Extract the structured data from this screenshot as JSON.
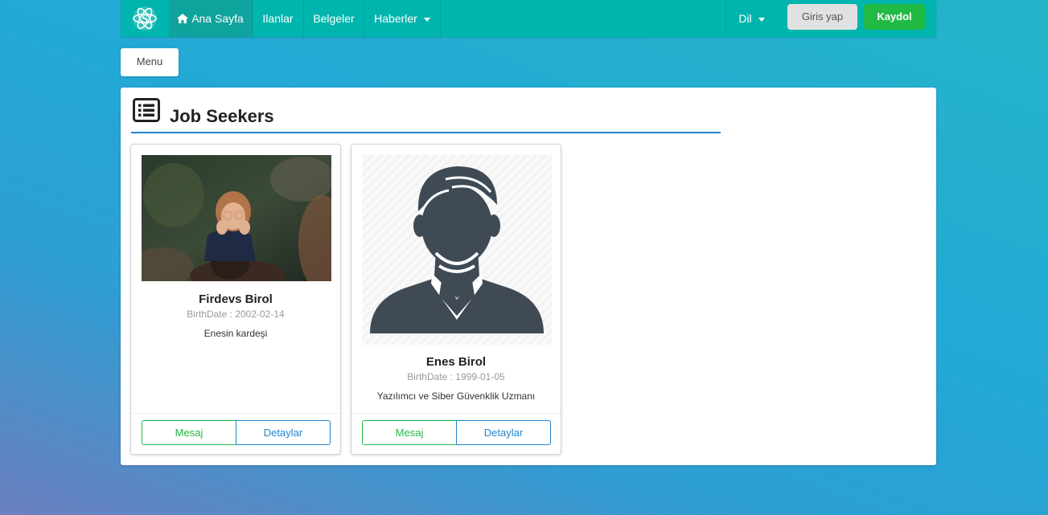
{
  "navbar": {
    "logo_icon": "atom-s-logo-icon",
    "items": [
      {
        "label": "Ana Sayfa",
        "icon": "home-icon",
        "active": true
      },
      {
        "label": "Ilanlar"
      },
      {
        "label": "Belgeler"
      },
      {
        "label": "Haberler",
        "dropdown": true
      }
    ],
    "language_label": "Dil",
    "login_label": "Giris yap",
    "signup_label": "Kaydol"
  },
  "menu_button": {
    "label": "Menu"
  },
  "panel": {
    "title": "Job Seekers",
    "title_icon": "list-icon",
    "cards": [
      {
        "name": "Firdevs Birol",
        "birthdate": "BirthDate : 2002-02-14",
        "description": "Enesin kardeşi",
        "image": "child-photo",
        "message_label": "Mesaj",
        "details_label": "Detaylar"
      },
      {
        "name": "Enes Birol",
        "birthdate": "BirthDate : 1999-01-05",
        "description": "Yazılımcı ve Siber Güvenklik Uzmanı",
        "image": "default-avatar-icon",
        "message_label": "Mesaj",
        "details_label": "Detaylar"
      }
    ]
  },
  "colors": {
    "navbar": "#00b5ad",
    "navbar_active": "#0ea39c",
    "signup": "#21ba45",
    "primary": "#2185d0",
    "login": "#e0e1e2"
  }
}
